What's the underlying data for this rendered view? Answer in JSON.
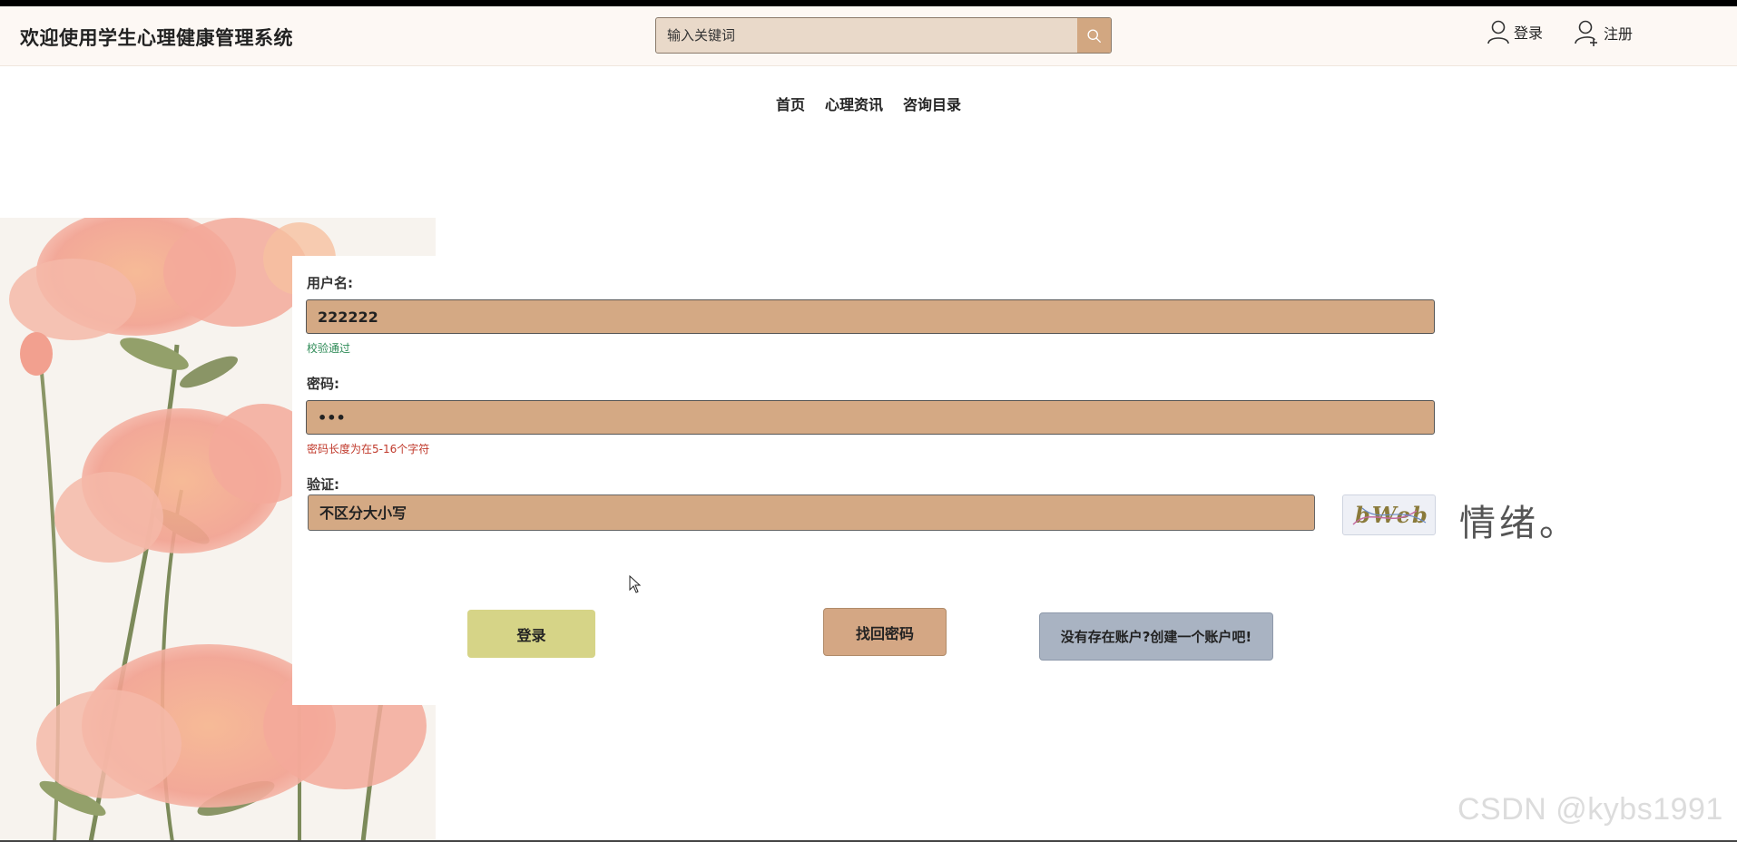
{
  "header": {
    "site_title": "欢迎使用学生心理健康管理系统",
    "search": {
      "placeholder": "输入关键词",
      "value": ""
    },
    "login_label": "登录",
    "register_label": "注册"
  },
  "nav": {
    "items": [
      {
        "label": "首页"
      },
      {
        "label": "心理资讯"
      },
      {
        "label": "咨询目录"
      }
    ]
  },
  "form": {
    "username": {
      "label": "用户名:",
      "value": "222222",
      "hint": "校验通过"
    },
    "password": {
      "label": "密码:",
      "value": "•••",
      "hint": "密码长度为在5-16个字符"
    },
    "captcha": {
      "label": "验证:",
      "placeholder": "不区分大小写",
      "value": "",
      "image_text": "bWeb"
    },
    "tagline": "情绪。",
    "buttons": {
      "login": "登录",
      "recover": "找回密码",
      "register": "没有存在账户?创建一个账户吧!"
    }
  },
  "watermark": "CSDN @kybs1991",
  "colors": {
    "input_bg": "#d4a984",
    "login_btn": "#d6d487",
    "recover_btn": "#d4a784",
    "register_btn": "#a9b3c2",
    "hint_ok": "#2e8b57",
    "hint_err": "#c0392b"
  }
}
